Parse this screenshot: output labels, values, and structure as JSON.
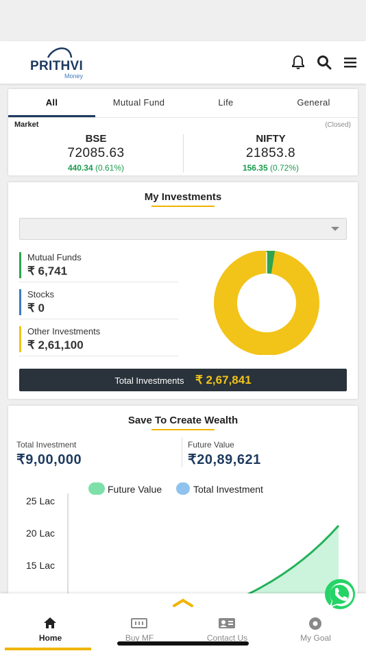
{
  "header": {
    "brand_main": "PRITHVI",
    "brand_sub": "Money",
    "icons": [
      "bell-icon",
      "search-icon",
      "menu-icon"
    ]
  },
  "tabs": [
    {
      "label": "All",
      "active": true
    },
    {
      "label": "Mutual Fund",
      "active": false
    },
    {
      "label": "Life",
      "active": false
    },
    {
      "label": "General",
      "active": false
    }
  ],
  "market": {
    "label": "Market",
    "status": "(Closed)",
    "bse": {
      "name": "BSE",
      "value": "72085.63",
      "change": "440.34",
      "pct": "(0.61%)"
    },
    "nifty": {
      "name": "NIFTY",
      "value": "21853.8",
      "change": "156.35",
      "pct": "(0.72%)"
    }
  },
  "investments": {
    "title": "My Investments",
    "items": [
      {
        "label": "Mutual Funds",
        "value": "₹ 6,741",
        "color": "#2ea44f"
      },
      {
        "label": "Stocks",
        "value": "₹ 0",
        "color": "#3b7bbf"
      },
      {
        "label": "Other Investments",
        "value": "₹ 2,61,100",
        "color": "#f2c318"
      }
    ],
    "total_label": "Total Investments",
    "total_value": "₹ 2,67,841",
    "donut": {
      "mutual_funds": 6741,
      "stocks": 0,
      "other": 261100
    }
  },
  "wealth": {
    "title": "Save To Create Wealth",
    "total_label": "Total Investment",
    "total_value": "₹9,00,000",
    "future_label": "Future Value",
    "future_value": "₹20,89,621",
    "legend": {
      "future": "Future Value",
      "total": "Total Investment"
    },
    "y_ticks": [
      "25 Lac",
      "20 Lac",
      "15 Lac"
    ]
  },
  "bottom_nav": [
    {
      "label": "Home",
      "icon": "home-icon",
      "active": true
    },
    {
      "label": "Buy MF",
      "icon": "money-icon",
      "active": false
    },
    {
      "label": "Contact Us",
      "icon": "contact-card-icon",
      "active": false
    },
    {
      "label": "My Goal",
      "icon": "goal-icon",
      "active": false
    }
  ],
  "colors": {
    "accent": "#f0b400",
    "nav_active": "#1e3a5f",
    "positive": "#1a9a4d"
  }
}
